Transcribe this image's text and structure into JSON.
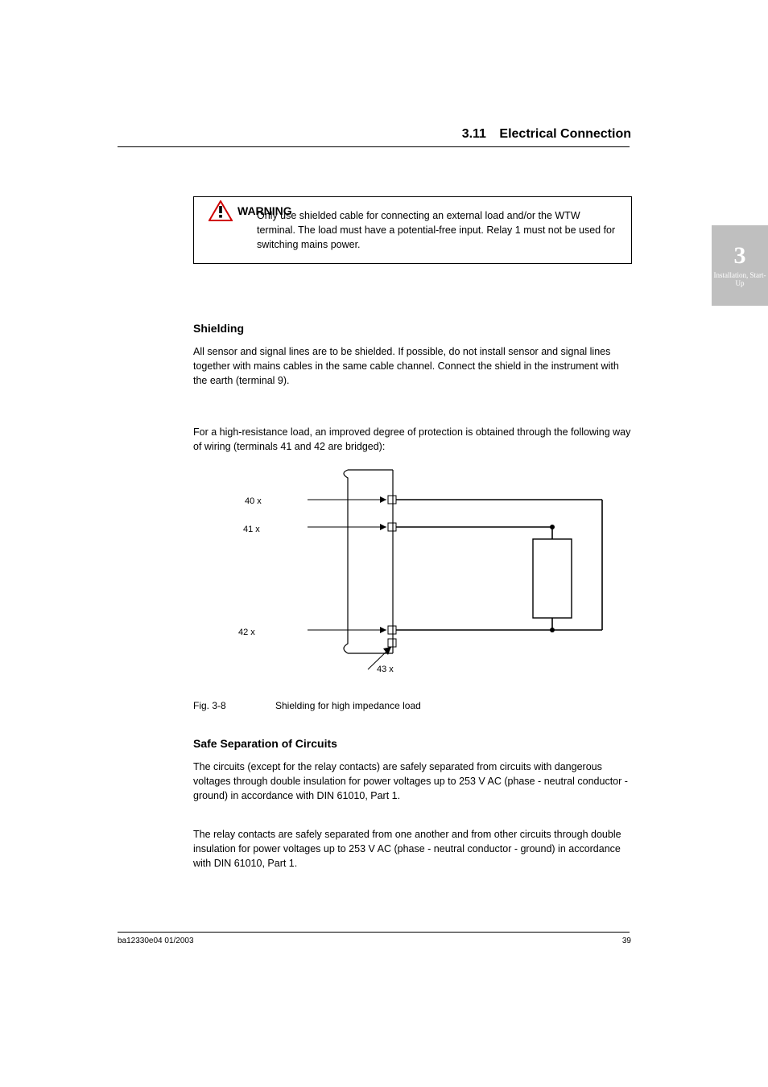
{
  "header": {
    "section_number": "3.11",
    "section_title": "Electrical Connection",
    "thumb_num": "3",
    "thumb_label": "Installation, Start-Up"
  },
  "warning": {
    "title": "WARNING",
    "text": "Only use shielded cable for connecting an external load and/or the WTW terminal. The load must have a potential-free input. Relay 1 must not be used for switching mains power."
  },
  "shielding": {
    "title": "Shielding",
    "p1": "All sensor and signal lines are to be shielded. If possible, do not install sensor and signal lines together with mains cables in the same cable channel. Connect the shield in the instrument with the earth (terminal 9).",
    "p2": "For a high-resistance load, an improved degree of protection is obtained through the following way of wiring (terminals 41 and 42 are bridged):"
  },
  "figure": {
    "labels": {
      "t40": "40        x",
      "t41": "41        x",
      "t42": "42        x",
      "t43": "43        x"
    },
    "caption_num": "Fig. 3-8",
    "caption_text": "Shielding for high impedance load"
  },
  "safe": {
    "title": "Safe Separation of Circuits",
    "p1": "The circuits (except for the relay contacts) are safely separated from circuits with dangerous voltages through double insulation for power voltages up to 253 V AC (phase - neutral conductor - ground) in accordance with DIN 61010, Part 1.",
    "p2": "The relay contacts are safely separated from one another and from other circuits through double insulation for power voltages up to 253 V AC (phase - neutral conductor - ground) in accordance with DIN 61010, Part 1."
  },
  "footer": {
    "left": "ba12330e04     01/2003",
    "right": "39"
  }
}
